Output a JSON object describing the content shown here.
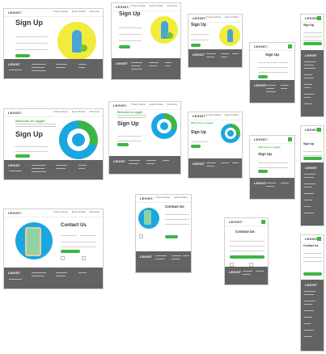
{
  "brand": {
    "logo": "LEGGIT",
    "green": "#3db543",
    "yellow": "#f1ec3c",
    "blue": "#1aa7e0",
    "footer": "#636363"
  },
  "nav": [
    "Project Listings",
    "Expert Profiles",
    "Resources"
  ],
  "signup": {
    "title": "Sign Up"
  },
  "welcome": {
    "title": "Welcome to Leggit!",
    "heading": "Sign Up"
  },
  "contact": {
    "title": "Contact Us"
  }
}
